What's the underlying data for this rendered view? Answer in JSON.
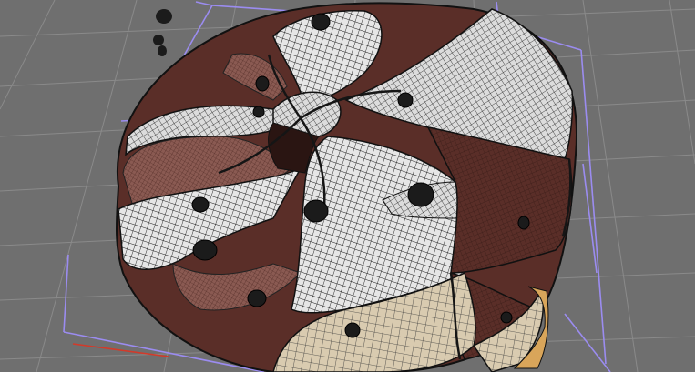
{
  "viewport": {
    "background": "#6f6f6f",
    "grid_color": "#8a8a8a",
    "bbox_color": "#9b8cf0",
    "axis_x_color": "#d23a2a",
    "axis_y_color": "#39c845",
    "mesh": {
      "brown": "#5a2e28",
      "brown_light": "#8a5a52",
      "white": "#e6e6e6",
      "grey": "#b9b9b9",
      "cream": "#d9cbb0",
      "wire": "#1a1a1a",
      "chip": "#1b1b1b",
      "base_orange": "#d9a55a"
    }
  }
}
